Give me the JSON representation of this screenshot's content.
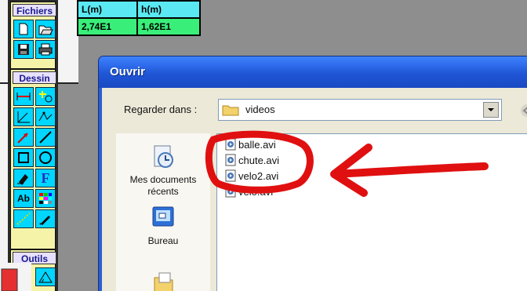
{
  "toolbox": {
    "fichiers_title": "Fichiers",
    "dessin_title": "Dessin",
    "outils_title": "Outils",
    "tools": {
      "text_tool": "Ab",
      "font_tool": "F"
    }
  },
  "measurements": {
    "headers": [
      "L(m)",
      "h(m)"
    ],
    "values": [
      "2,74E1",
      "1,62E1"
    ]
  },
  "dialog": {
    "title": "Ouvrir",
    "look_in_label": "Regarder dans :",
    "look_in_value": "videos",
    "places": [
      {
        "label": "Mes documents récents",
        "icon": "recent-documents-icon"
      },
      {
        "label": "Bureau",
        "icon": "desktop-icon"
      }
    ],
    "files": [
      {
        "name": "balle.avi"
      },
      {
        "name": "chute.avi"
      },
      {
        "name": "velo2.avi"
      },
      {
        "name": "velo.avi"
      }
    ]
  },
  "colors": {
    "tool_bg": "#00d6ff",
    "title_bar": "#2a5fd1",
    "annotation": "#e01010",
    "measure_header": "#5ae8f2",
    "measure_value": "#39ef7a"
  }
}
